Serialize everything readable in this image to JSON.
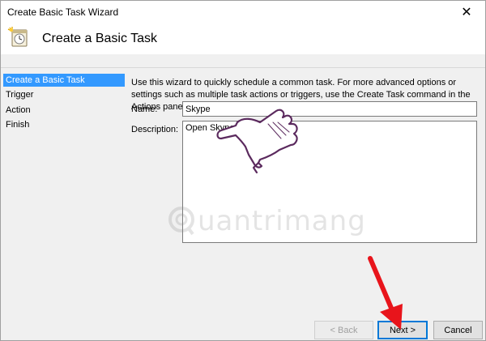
{
  "window": {
    "title": "Create Basic Task Wizard",
    "close_glyph": "✕",
    "header_title": "Create a Basic Task"
  },
  "nav": {
    "items": [
      {
        "label": "Create a Basic Task",
        "selected": true
      },
      {
        "label": "Trigger",
        "selected": false
      },
      {
        "label": "Action",
        "selected": false
      },
      {
        "label": "Finish",
        "selected": false
      }
    ]
  },
  "main": {
    "intro": "Use this wizard to quickly schedule a common task.  For more advanced options or settings such as multiple task actions or triggers, use the Create Task command in the Actions pane.",
    "name_label": "Name:",
    "name_value": "Skype",
    "description_label": "Description:",
    "description_value": "Open Skype"
  },
  "buttons": {
    "back": "< Back",
    "next": "Next >",
    "cancel": "Cancel"
  },
  "watermark": {
    "text": "uantrimang"
  },
  "colors": {
    "selection": "#3399ff",
    "arrow": "#e8141b",
    "hand": "#5b2a5e",
    "default_button_border": "#0078d7"
  },
  "icons": {
    "task": "scheduled-task-icon",
    "close": "close-icon",
    "hand": "pointing-hand-icon",
    "arrow": "red-arrow-icon"
  }
}
